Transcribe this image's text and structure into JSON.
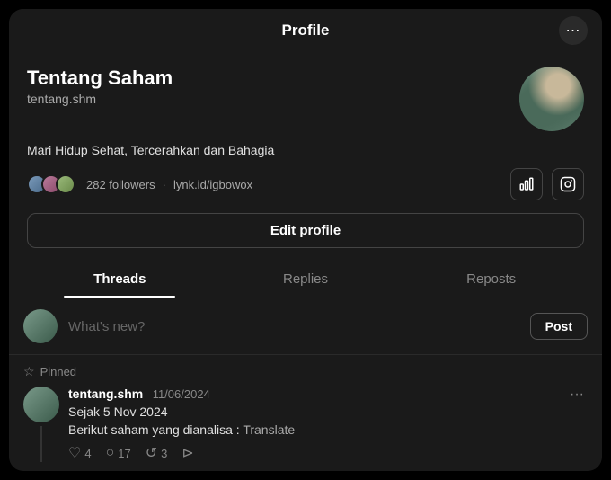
{
  "header": {
    "title": "Profile",
    "menu_icon": "⋯"
  },
  "profile": {
    "name": "Tentang Saham",
    "handle": "tentang.shm",
    "bio": "Mari Hidup Sehat, Tercerahkan dan Bahagia",
    "followers_count": "282 followers",
    "link": "lynk.id/igbowox",
    "edit_label": "Edit profile"
  },
  "tabs": [
    {
      "label": "Threads",
      "active": true
    },
    {
      "label": "Replies",
      "active": false
    },
    {
      "label": "Reposts",
      "active": false
    }
  ],
  "new_post": {
    "placeholder": "What's new?",
    "post_button": "Post"
  },
  "pinned": {
    "label": "Pinned",
    "thread": {
      "author": "tentang.shm",
      "date": "11/06/2024",
      "subtitle": "Sejak 5 Nov 2024",
      "body": "Berikut saham yang dianalisa :",
      "translate": "Translate",
      "likes": "4",
      "comments": "17",
      "reposts": "3"
    }
  }
}
